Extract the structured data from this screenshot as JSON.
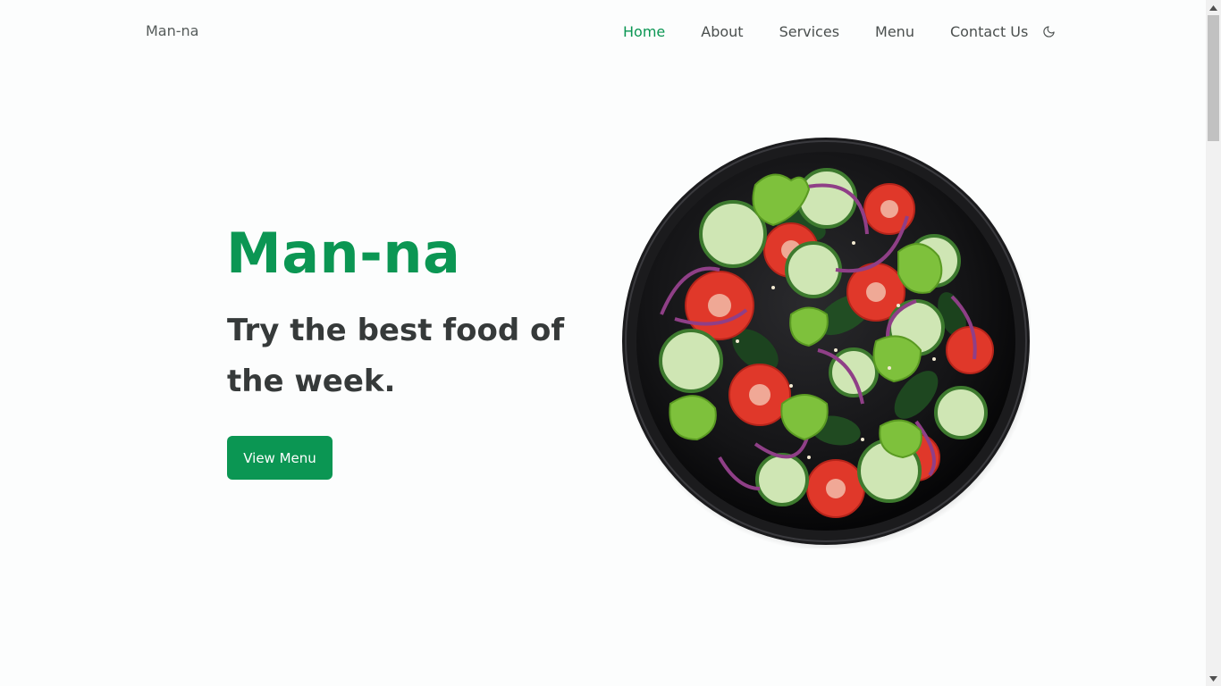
{
  "header": {
    "brand": "Man-na",
    "nav": [
      {
        "label": "Home",
        "active": true
      },
      {
        "label": "About",
        "active": false
      },
      {
        "label": "Services",
        "active": false
      },
      {
        "label": "Menu",
        "active": false
      },
      {
        "label": "Contact Us",
        "active": false
      }
    ],
    "theme_toggle_icon": "moon-icon"
  },
  "hero": {
    "title": "Man-na",
    "subtitle": "Try the best food of the week.",
    "button_label": "View Menu",
    "image_icon": "salad-plate-image"
  },
  "colors": {
    "accent": "#0b9653",
    "text_dark": "#363a3a",
    "nav_text": "#4a4f4e",
    "background": "#fcfdfd"
  }
}
